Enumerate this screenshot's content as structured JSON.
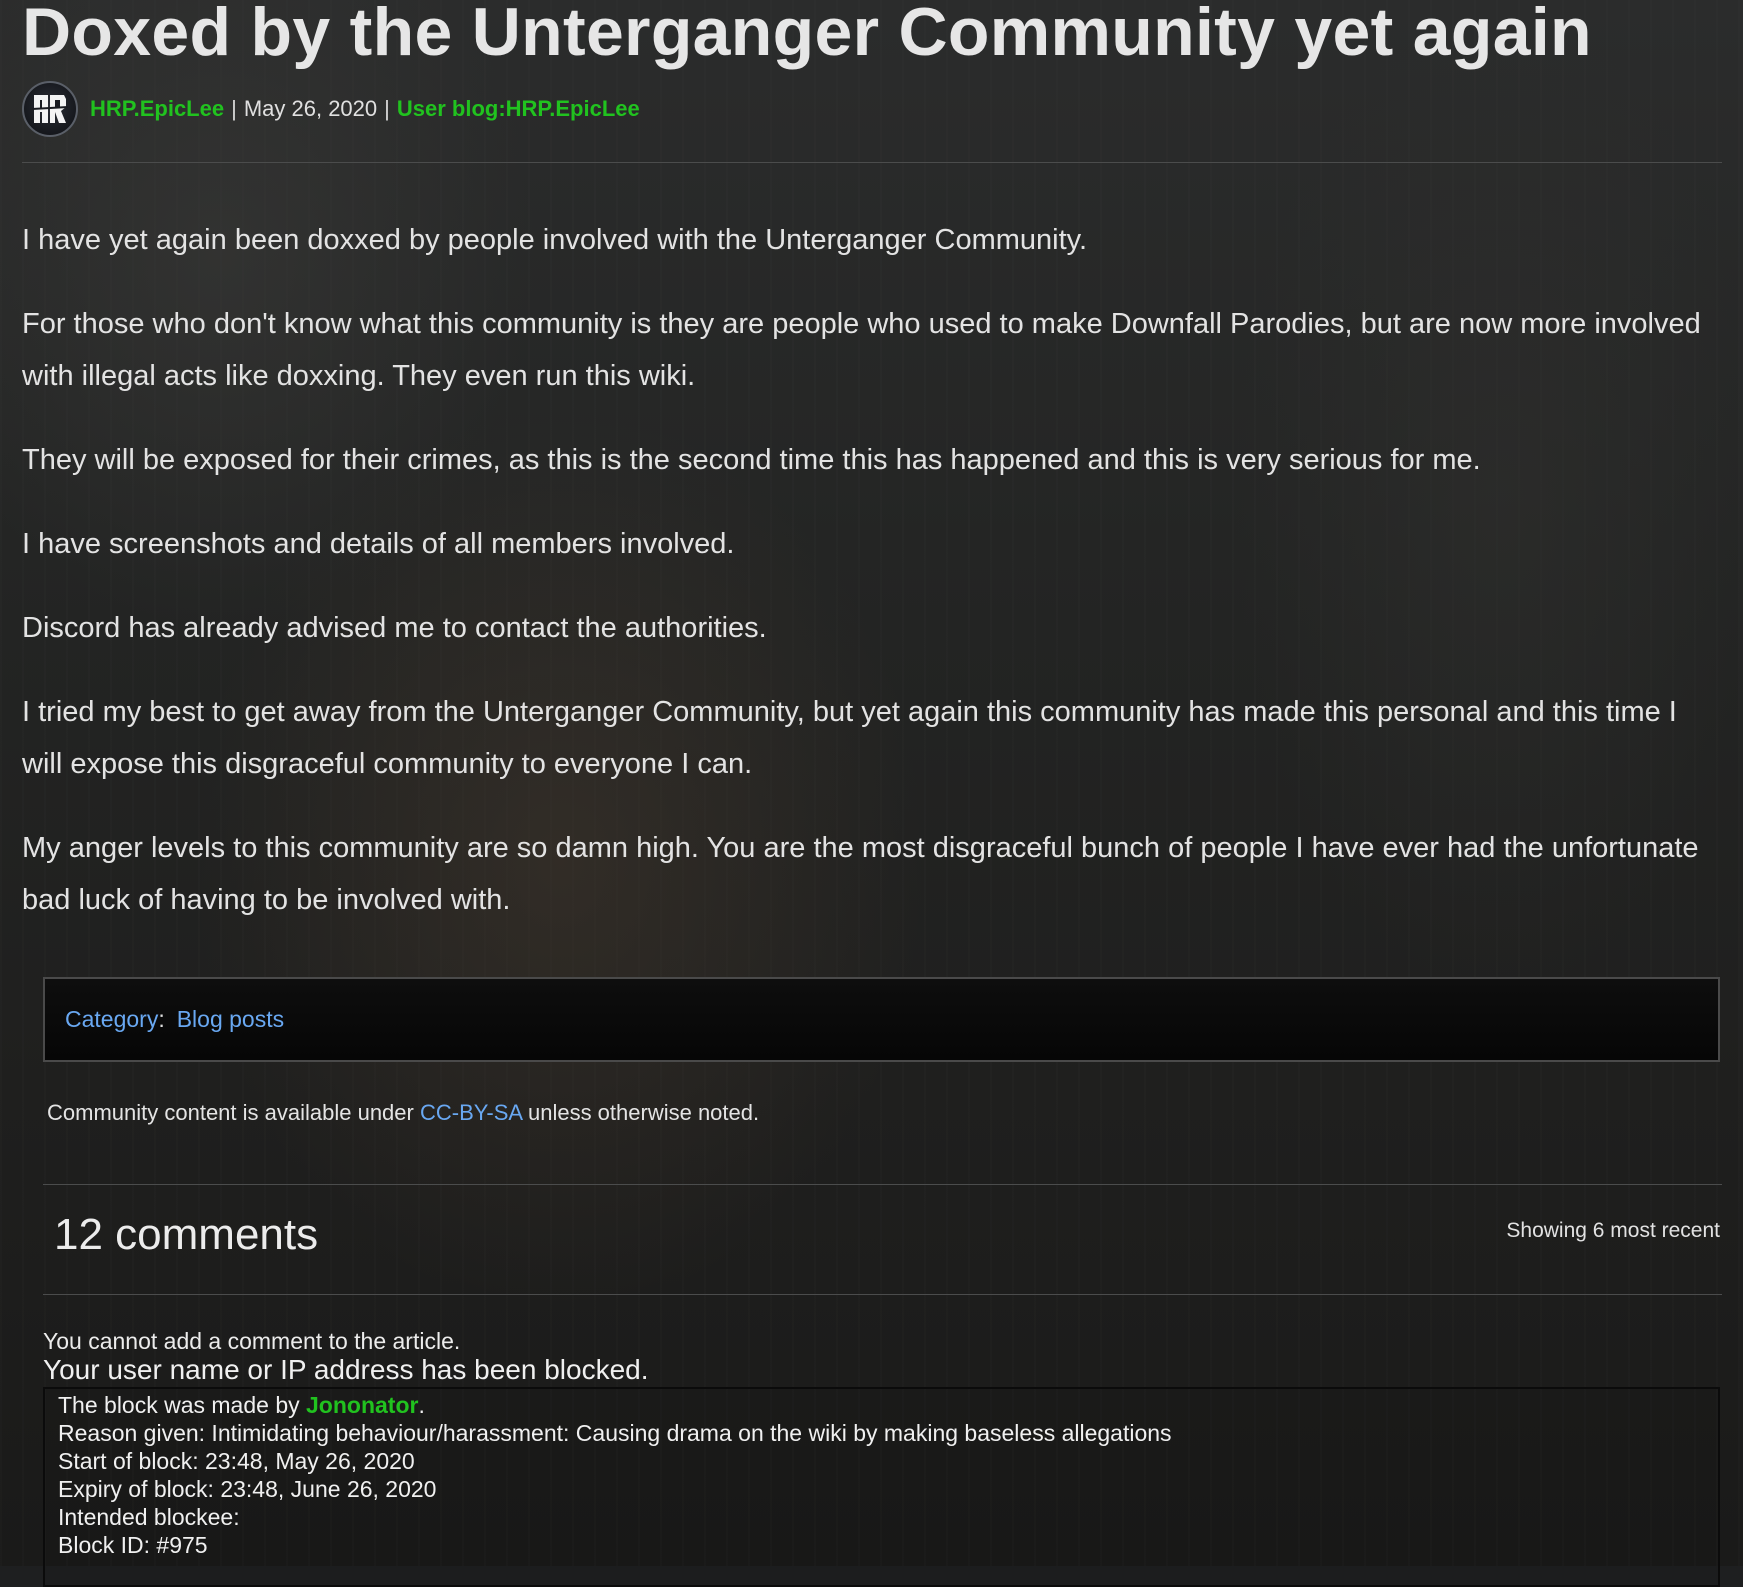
{
  "post": {
    "title": "Doxed by the Unterganger Community yet again",
    "author": "HRP.EpicLee",
    "date": "May 26, 2020",
    "separator": "|",
    "blog_link": "User blog:HRP.EpicLee",
    "avatar_icon": "hr-logo-avatar",
    "paragraphs": [
      "I have yet again been doxxed by people involved with the Unterganger Community.",
      "For those who don't know what this community is they are people who used to make Downfall Parodies, but are now more involved with illegal acts like doxxing. They even run this wiki.",
      "They will be exposed for their crimes, as this is the second time this has happened and this is very serious for me.",
      "I have screenshots and details of all members involved.",
      "Discord has already advised me to contact the authorities.",
      "I tried my best to get away from the Unterganger Community, but yet again this community has made this personal and this time I will expose this disgraceful community to everyone I can.",
      "My anger levels to this community are so damn high. You are the most disgraceful bunch of people I have ever had the unfortunate bad luck of having to be involved with."
    ]
  },
  "categories": {
    "label": "Category",
    "colon": ":",
    "items": [
      "Blog posts"
    ]
  },
  "license": {
    "before": "Community content is available under ",
    "link": "CC-BY-SA",
    "after": " unless otherwise noted."
  },
  "comments": {
    "title": "12 comments",
    "showing": "Showing 6 most recent",
    "cannot_add": "You cannot add a comment to the article.",
    "blocked_heading": "Your user name or IP address has been blocked.",
    "block_info": {
      "made_by_prefix": "The block was made by ",
      "made_by_user": "Jononator",
      "made_by_suffix": ".",
      "reason": "Reason given: Intimidating behaviour/harassment: Causing drama on the wiki by making baseless allegations",
      "start": "Start of block: 23:48, May 26, 2020",
      "expiry": "Expiry of block: 23:48, June 26, 2020",
      "intended": "Intended blockee:",
      "block_id": "Block ID: #975"
    }
  },
  "colors": {
    "link_green": "#21c21f",
    "link_blue": "#69a8f2",
    "text": "#e3e3e3",
    "background": "#1e1f20"
  }
}
